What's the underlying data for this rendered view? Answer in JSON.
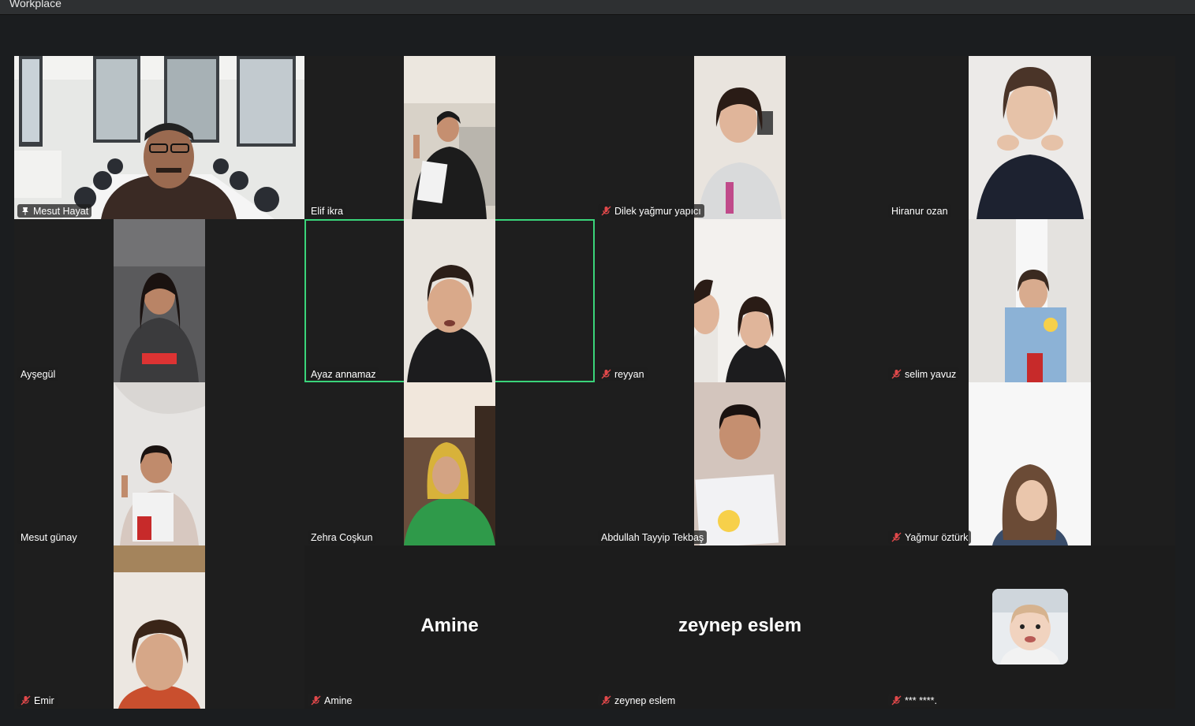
{
  "window": {
    "title": "Workplace"
  },
  "colors": {
    "active_speaker": "#3ad47a",
    "muted_icon": "#e0484a",
    "background": "#1b1d1f",
    "tile": "#1e1e1e"
  },
  "participants": [
    {
      "name": "Mesut Hayat",
      "status": "pinned"
    },
    {
      "name": "Elif ikra",
      "status": ""
    },
    {
      "name": "Dilek yağmur yapıcı",
      "status": "muted"
    },
    {
      "name": "Hiranur ozan",
      "status": ""
    },
    {
      "name": "Ayşegül",
      "status": ""
    },
    {
      "name": "Ayaz annamaz",
      "status": "active-speaker"
    },
    {
      "name": "reyyan",
      "status": "muted"
    },
    {
      "name": "selim yavuz",
      "status": "muted"
    },
    {
      "name": "Mesut günay",
      "status": ""
    },
    {
      "name": "Zehra Coşkun",
      "status": ""
    },
    {
      "name": "Abdullah Tayyip Tekbaş",
      "status": ""
    },
    {
      "name": "Yağmur öztürk",
      "status": "muted"
    },
    {
      "name": "Emir",
      "status": "muted"
    },
    {
      "name": "Amine",
      "status": "muted",
      "placeholder": "Amine"
    },
    {
      "name": "zeynep eslem",
      "status": "muted",
      "placeholder": "zeynep eslem"
    },
    {
      "name": "*** ****.",
      "status": "muted"
    }
  ]
}
